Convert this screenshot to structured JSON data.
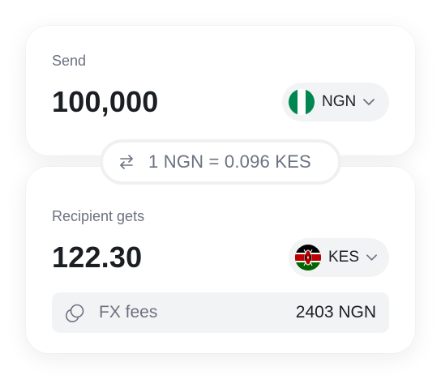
{
  "send": {
    "label": "Send",
    "amount": "100,000",
    "currency": {
      "code": "NGN",
      "flag_icon": "nigeria-flag-icon",
      "chevron_icon": "chevron-down-icon"
    }
  },
  "rate": {
    "icon": "swap-arrows-icon",
    "text": "1 NGN = 0.096 KES"
  },
  "recipient": {
    "label": "Recipient gets",
    "amount": "122.30",
    "currency": {
      "code": "KES",
      "flag_icon": "kenya-flag-icon",
      "chevron_icon": "chevron-down-icon"
    }
  },
  "fees": {
    "icon": "coins-icon",
    "label": "FX fees",
    "value": "2403 NGN"
  },
  "colors": {
    "text_primary": "#1b1f24",
    "text_secondary": "#6b7280",
    "chip_background": "#f2f3f5",
    "nigeria_green": "#008751",
    "kenya_red": "#bb0000",
    "kenya_green": "#006600"
  }
}
